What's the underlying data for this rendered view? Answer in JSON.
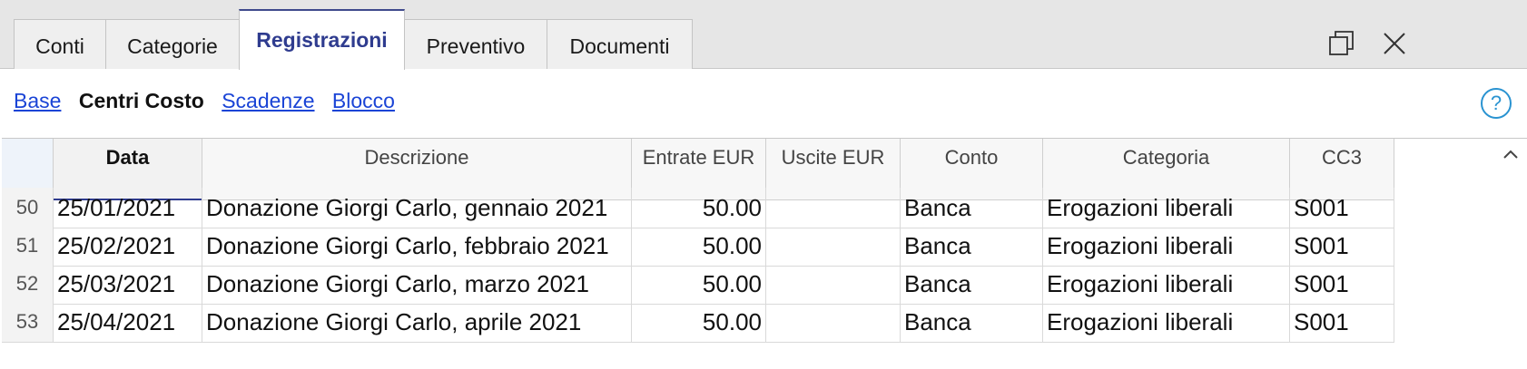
{
  "tabs": [
    "Conti",
    "Categorie",
    "Registrazioni",
    "Preventivo",
    "Documenti"
  ],
  "active_tab": "Registrazioni",
  "views": {
    "base": "Base",
    "centri_costo": "Centri Costo",
    "scadenze": "Scadenze",
    "blocco": "Blocco"
  },
  "help_label": "?",
  "columns": {
    "data": "Data",
    "descrizione": "Descrizione",
    "entrate": "Entrate EUR",
    "uscite": "Uscite EUR",
    "conto": "Conto",
    "categoria": "Categoria",
    "cc3": "CC3"
  },
  "rows": [
    {
      "n": "50",
      "data": "25/01/2021",
      "descrizione": "Donazione Giorgi Carlo, gennaio 2021",
      "entrate": "50.00",
      "uscite": "",
      "conto": "Banca",
      "categoria": "Erogazioni liberali",
      "cc3": "S001"
    },
    {
      "n": "51",
      "data": "25/02/2021",
      "descrizione": "Donazione Giorgi Carlo, febbraio 2021",
      "entrate": "50.00",
      "uscite": "",
      "conto": "Banca",
      "categoria": "Erogazioni liberali",
      "cc3": "S001"
    },
    {
      "n": "52",
      "data": "25/03/2021",
      "descrizione": "Donazione Giorgi Carlo, marzo 2021",
      "entrate": "50.00",
      "uscite": "",
      "conto": "Banca",
      "categoria": "Erogazioni liberali",
      "cc3": "S001"
    },
    {
      "n": "53",
      "data": "25/04/2021",
      "descrizione": "Donazione Giorgi Carlo, aprile 2021",
      "entrate": "50.00",
      "uscite": "",
      "conto": "Banca",
      "categoria": "Erogazioni liberali",
      "cc3": "S001"
    }
  ],
  "icons": {
    "restore": "restore-window-icon",
    "close": "close-icon",
    "scroll_up": "scroll-up-chevron-icon",
    "help": "help-icon"
  },
  "colors": {
    "active_tab_text": "#2f3c8f",
    "link": "#1a44d6",
    "help": "#2a93d1"
  }
}
